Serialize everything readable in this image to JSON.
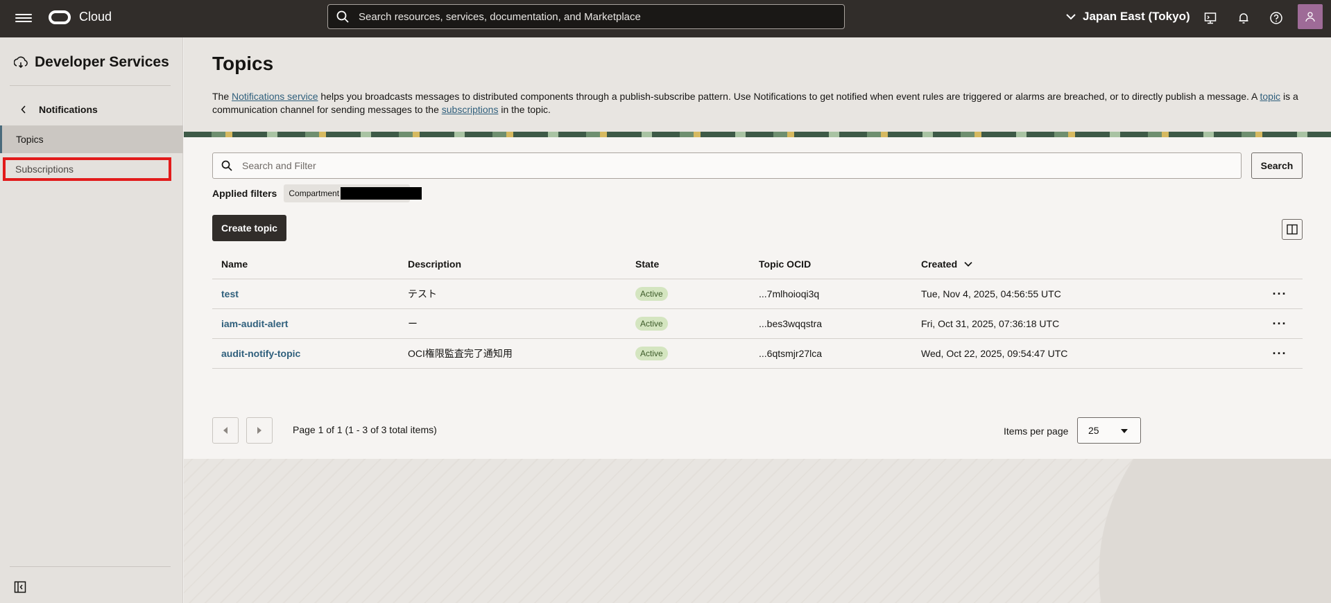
{
  "topbar": {
    "brand": "Cloud",
    "search_placeholder": "Search resources, services, documentation, and Marketplace",
    "region": "Japan East (Tokyo)"
  },
  "sidebar": {
    "title": "Developer Services",
    "back_label": "Notifications",
    "items": [
      {
        "label": "Topics",
        "active": true
      },
      {
        "label": "Subscriptions",
        "active": false
      }
    ]
  },
  "main": {
    "title": "Topics",
    "intro": {
      "p1": "The ",
      "link1": "Notifications service",
      "p2": " helps you broadcasts messages to distributed components through a publish-subscribe pattern. Use Notifications to get notified when event rules are triggered or alarms are breached, or to directly publish a message. A ",
      "link2": "topic",
      "p3": " is a communication channel for sending messages to the ",
      "link3": "subscriptions",
      "p4": " in the topic."
    },
    "filter_placeholder": "Search and Filter",
    "search_button": "Search",
    "applied_filters_label": "Applied filters",
    "filter_chip": "Compartment",
    "create_button": "Create topic",
    "table": {
      "headers": {
        "name": "Name",
        "description": "Description",
        "state": "State",
        "ocid": "Topic OCID",
        "created": "Created"
      },
      "rows": [
        {
          "name": "test",
          "description": "テスト",
          "state": "Active",
          "ocid": "...7mlhoioqi3q",
          "created": "Tue, Nov 4, 2025, 04:56:55 UTC"
        },
        {
          "name": "iam-audit-alert",
          "description": "ー",
          "state": "Active",
          "ocid": "...bes3wqqstra",
          "created": "Fri, Oct 31, 2025, 07:36:18 UTC"
        },
        {
          "name": "audit-notify-topic",
          "description": "OCI権限監査完了通知用",
          "state": "Active",
          "ocid": "...6qtsmjr27lca",
          "created": "Wed, Oct 22, 2025, 09:54:47 UTC"
        }
      ]
    },
    "pagination": {
      "text": "Page 1 of 1 (1 - 3 of 3 total items)",
      "items_per_page_label": "Items per page",
      "items_per_page": "25"
    }
  },
  "colors": {
    "topbar": "#312d2a",
    "link": "#2f5f7c",
    "badge_bg": "#d4e5c0",
    "highlight": "#e21b1b"
  }
}
